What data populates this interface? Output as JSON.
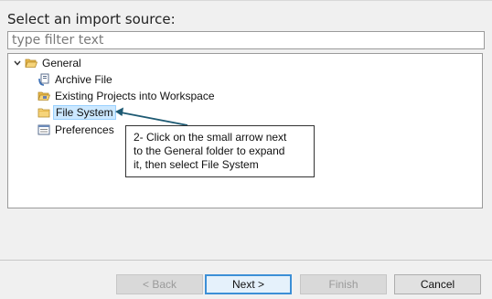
{
  "heading": "Select an import source:",
  "filter": {
    "placeholder": "type filter text",
    "value": ""
  },
  "tree": {
    "items": [
      {
        "label": "General",
        "icon": "folder-open-icon",
        "expanded": true
      },
      {
        "label": "Archive File",
        "icon": "archive-file-icon"
      },
      {
        "label": "Existing Projects into Workspace",
        "icon": "projects-icon"
      },
      {
        "label": "File System",
        "icon": "folder-icon",
        "selected": true
      },
      {
        "label": "Preferences",
        "icon": "preferences-icon"
      }
    ]
  },
  "callout": {
    "lines": [
      "2- Click on the small arrow next",
      "to the General folder to expand",
      "it, then select File System"
    ]
  },
  "buttons": {
    "back": "< Back",
    "next": "Next >",
    "finish": "Finish",
    "cancel": "Cancel"
  },
  "colors": {
    "selection": "#cce8ff",
    "arrow": "#1e5a73",
    "default_button_border": "#3c8fd6"
  }
}
